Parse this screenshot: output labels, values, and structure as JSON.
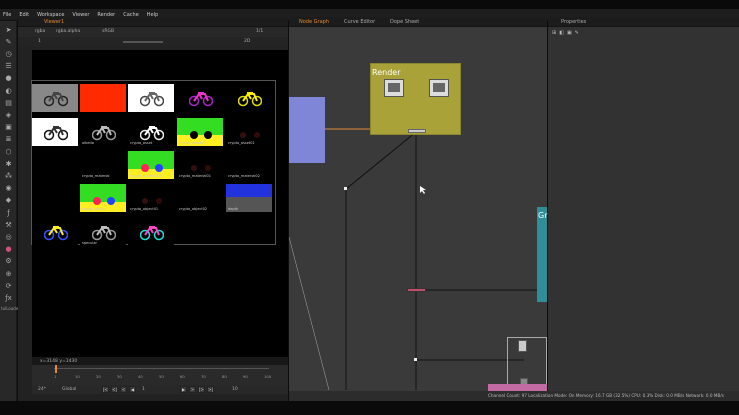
{
  "menu": [
    "File",
    "Edit",
    "Workspace",
    "Viewer",
    "Render",
    "Cache",
    "Help"
  ],
  "toolbar": {
    "bottom_label": "tulLoader",
    "icons": [
      "pointer-icon",
      "brush-icon",
      "clock-icon",
      "list-icon",
      "sphere-icon",
      "channel-icon",
      "film-icon",
      "paint-icon",
      "cube-icon",
      "layers-icon",
      "3d-icon",
      "light-icon",
      "particle-icon",
      "eye-icon",
      "tag-icon",
      "fx-icon",
      "wrench-icon",
      "merge-icon",
      "circle-icon",
      "gear-icon",
      "globe-icon",
      "refresh-icon",
      "ofx-icon"
    ]
  },
  "viewer": {
    "tab": "Viewer1",
    "layer": "rgba",
    "channel": "rgba.alpha",
    "colorspace": "sRGB",
    "frame": "1",
    "zoom": "1/1",
    "mode": "2D",
    "coord": "x=3148 y=1430",
    "cells": [
      {
        "label": "",
        "row": 0,
        "col": 0,
        "bg": "#888888",
        "kind": "photo"
      },
      {
        "label": "",
        "row": 0,
        "col": 1,
        "bg": "#ff2a00",
        "kind": "solid"
      },
      {
        "label": "",
        "row": 0,
        "col": 2,
        "bg": "#ffffff",
        "kind": "moto-dark"
      },
      {
        "label": "",
        "row": 0,
        "col": 3,
        "bg": "#000000",
        "kind": "moto-magenta"
      },
      {
        "label": "",
        "row": 0,
        "col": 4,
        "bg": "#000000",
        "kind": "moto-yellow"
      },
      {
        "label": "",
        "row": 1,
        "col": 0,
        "bg": "#ffffff",
        "kind": "moto-outline"
      },
      {
        "label": "albedo",
        "row": 1,
        "col": 1,
        "bg": "#000000",
        "kind": "moto-grey"
      },
      {
        "label": "crypto_asset",
        "row": 1,
        "col": 2,
        "bg": "#000000",
        "kind": "moto-white"
      },
      {
        "label": "crypto_asset00",
        "row": 1,
        "col": 3,
        "bg": "#33dd22",
        "kind": "green"
      },
      {
        "label": "crypto_asset01",
        "row": 1,
        "col": 4,
        "bg": "#000000",
        "kind": "dark-red"
      },
      {
        "label": "crypto_material",
        "row": 2,
        "col": 1,
        "bg": "#000000",
        "kind": "empty"
      },
      {
        "label": "crypto_material00",
        "row": 2,
        "col": 2,
        "bg": "#33dd22",
        "kind": "green-yellow"
      },
      {
        "label": "crypto_material01",
        "row": 2,
        "col": 3,
        "bg": "#000000",
        "kind": "dark-red"
      },
      {
        "label": "crypto_material02",
        "row": 2,
        "col": 4,
        "bg": "#000000",
        "kind": "empty"
      },
      {
        "label": "crypto_object",
        "row": 3,
        "col": 1,
        "bg": "#33dd22",
        "kind": "green-yellow"
      },
      {
        "label": "crypto_object01",
        "row": 3,
        "col": 2,
        "bg": "#000000",
        "kind": "dark-red"
      },
      {
        "label": "crypto_object02",
        "row": 3,
        "col": 3,
        "bg": "#000000",
        "kind": "empty"
      },
      {
        "label": "depth",
        "row": 3,
        "col": 4,
        "bg": "#2233dd",
        "kind": "blue-grey"
      },
      {
        "label": "",
        "row": 4,
        "col": 0,
        "bg": "#000000",
        "kind": "moto-rgb"
      },
      {
        "label": "specular",
        "row": 4,
        "col": 1,
        "bg": "#000000",
        "kind": "moto-grey"
      },
      {
        "label": "",
        "row": 4,
        "col": 2,
        "bg": "#000000",
        "kind": "moto-cyan"
      }
    ],
    "timeline": {
      "ticks": [
        "1",
        "10",
        "20",
        "30",
        "40",
        "50",
        "60",
        "70",
        "80",
        "90",
        "100"
      ],
      "fps": "24*",
      "mode": "Global",
      "frame": "1",
      "end": "10",
      "range_end": "100"
    }
  },
  "nodegraph": {
    "tabs": [
      "Node Graph",
      "Curve Editor",
      "Dope Sheet"
    ],
    "render_label": "Render",
    "group_label": "Gr"
  },
  "properties": {
    "tab": "Properties"
  },
  "status": "Channel Count: 97  Localization Mode: On  Memory: 16.7 GB (32.5%)  CPU: 0.3%  Disk: 0.0 MB/s  Network: 0.0 MB/s",
  "colors": {
    "accent": "#e68a2e",
    "node_yellow": "#a8a238",
    "node_blue": "#7f86d8",
    "node_teal": "#2e8f9a",
    "node_pink": "#c26aa4"
  }
}
